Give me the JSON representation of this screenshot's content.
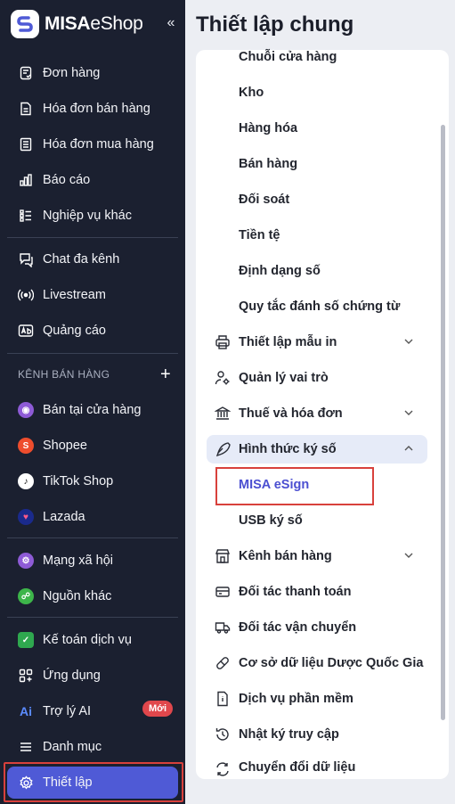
{
  "brand": {
    "name_bold": "MISA",
    "name_thin": "eShop",
    "collapse": "«"
  },
  "sidebar": {
    "items_top": [
      {
        "label": "Đơn hàng",
        "icon": "order-icon"
      },
      {
        "label": "Hóa đơn bán hàng",
        "icon": "sales-invoice-icon"
      },
      {
        "label": "Hóa đơn mua hàng",
        "icon": "purchase-invoice-icon"
      },
      {
        "label": "Báo cáo",
        "icon": "report-icon"
      },
      {
        "label": "Nghiệp vụ khác",
        "icon": "list-icon"
      }
    ],
    "items_mid": [
      {
        "label": "Chat đa kênh",
        "icon": "chat-icon"
      },
      {
        "label": "Livestream",
        "icon": "livestream-icon"
      },
      {
        "label": "Quảng cáo",
        "icon": "ad-icon"
      }
    ],
    "channels_title": "KÊNH BÁN HÀNG",
    "channels_add": "+",
    "channels": [
      {
        "label": "Bán tại cửa hàng",
        "icon": "store-icon",
        "color": "#8e5bd6"
      },
      {
        "label": "Shopee",
        "icon": "shopee-icon",
        "color": "#ee4d2d"
      },
      {
        "label": "TikTok Shop",
        "icon": "tiktok-icon",
        "color": "#111111"
      },
      {
        "label": "Lazada",
        "icon": "lazada-icon",
        "color": "#1a2a8c"
      }
    ],
    "items_social": [
      {
        "label": "Mạng xã hội",
        "icon": "social-icon",
        "color": "#8e5bd6"
      },
      {
        "label": "Nguồn khác",
        "icon": "cart-icon",
        "color": "#3db54a"
      }
    ],
    "items_bottom": [
      {
        "label": "Kế toán dịch vụ",
        "icon": "accounting-icon",
        "color": "#2fa84f"
      },
      {
        "label": "Ứng dụng",
        "icon": "apps-icon"
      },
      {
        "label": "Trợ lý AI",
        "icon": "ai-icon",
        "badge": "Mới"
      },
      {
        "label": "Danh mục",
        "icon": "menu-icon"
      },
      {
        "label": "Thiết lập",
        "icon": "settings-icon"
      }
    ]
  },
  "main": {
    "title": "Thiết lập chung",
    "sub_items": [
      "Chuỗi cửa hàng",
      "Kho",
      "Hàng hóa",
      "Bán hàng",
      "Đối soát",
      "Tiền tệ",
      "Định dạng số",
      "Quy tắc đánh số chứng từ"
    ],
    "menu": [
      {
        "label": "Thiết lập mẫu in",
        "icon": "printer-icon"
      },
      {
        "label": "Quản lý vai trò",
        "icon": "user-gear-icon"
      },
      {
        "label": "Thuế và hóa đơn",
        "icon": "bank-icon"
      },
      {
        "label": "Hình thức ký số",
        "icon": "pen-icon"
      },
      {
        "label": "Kênh bán hàng",
        "icon": "shop-icon"
      },
      {
        "label": "Đối tác thanh toán",
        "icon": "card-icon"
      },
      {
        "label": "Đối tác vận chuyển",
        "icon": "truck-icon"
      },
      {
        "label": "Cơ sở dữ liệu Dược Quốc Gia",
        "icon": "pill-icon"
      },
      {
        "label": "Dịch vụ phần mềm",
        "icon": "doc-icon"
      },
      {
        "label": "Nhật ký truy cập",
        "icon": "history-icon"
      },
      {
        "label": "Chuyển đổi dữ liệu",
        "icon": "convert-icon"
      }
    ],
    "sign_sub": [
      "MISA eSign",
      "USB ký số"
    ]
  },
  "colors": {
    "sidebar_bg": "#1b2030",
    "active_bg": "#4f5ad6",
    "accent": "#4b4fd1",
    "highlight": "#d8413c"
  }
}
